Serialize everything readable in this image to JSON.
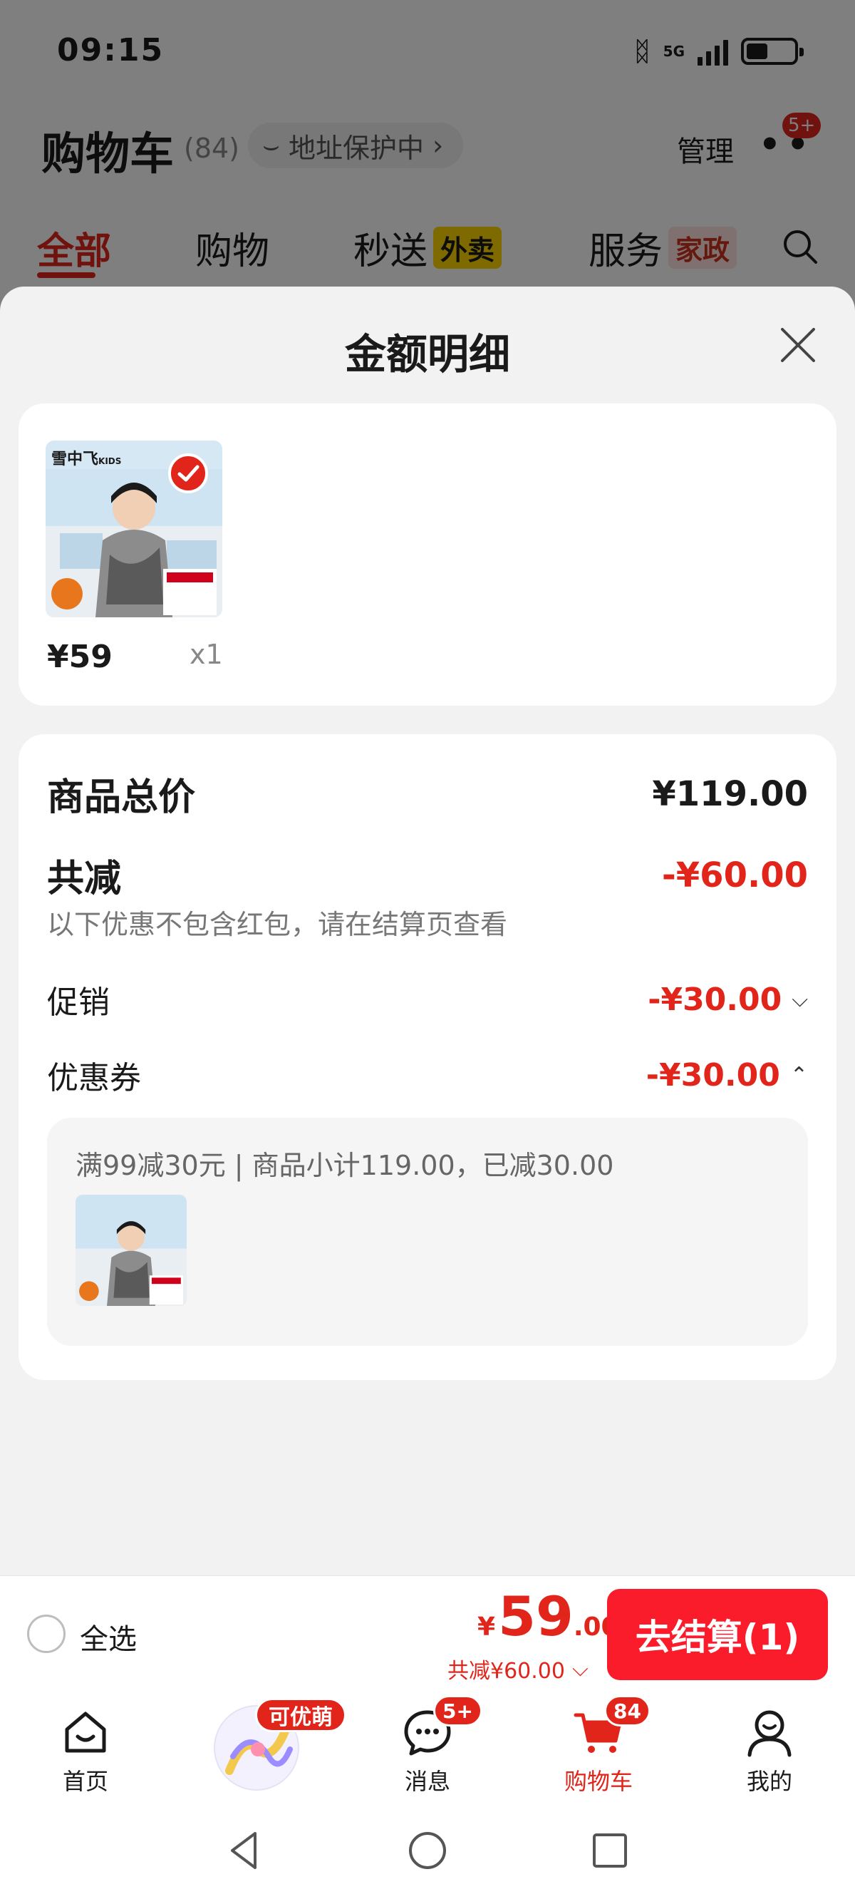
{
  "status_bar": {
    "time": "09:15",
    "network": "5G",
    "bluetooth_icon": "bluetooth-icon",
    "battery_level": 0.45
  },
  "cart_header": {
    "title": "购物车",
    "count": "(84)",
    "address_text": "地址保护中",
    "manage_label": "管理",
    "more_badge": "5+"
  },
  "top_tabs": [
    {
      "label": "全部",
      "tag": ""
    },
    {
      "label": "购物",
      "tag": ""
    },
    {
      "label": "秒送",
      "tag": "外卖"
    },
    {
      "label": "服务",
      "tag": "家政"
    }
  ],
  "sheet": {
    "title": "金额明细",
    "product": {
      "price": "¥59",
      "qty": "x1",
      "brand_text": "雪中飞KIDS"
    },
    "summary": {
      "total_label": "商品总价",
      "total_value": "¥119.00",
      "discount_label": "共减",
      "discount_value": "-¥60.00",
      "note": "以下优惠不包含红包，请在结算页查看",
      "promo_label": "促销",
      "promo_value": "-¥30.00",
      "coupon_label": "优惠券",
      "coupon_value": "-¥30.00",
      "coupon_detail": "满99减30元 | 商品小计119.00，已减30.00"
    }
  },
  "checkout": {
    "select_all": "全选",
    "currency": "¥",
    "price_int": "59",
    "price_dec": ".00",
    "discount_text": "共减¥60.00",
    "button_label": "去结算(1)"
  },
  "bottom_nav": [
    {
      "label": "首页",
      "icon": "home-icon"
    },
    {
      "label": "",
      "icon": "promo-icon",
      "badge": "可优萌"
    },
    {
      "label": "消息",
      "icon": "message-icon",
      "badge": "5+"
    },
    {
      "label": "购物车",
      "icon": "cart-icon",
      "badge": "84"
    },
    {
      "label": "我的",
      "icon": "profile-icon"
    }
  ],
  "colors": {
    "accent": "#e1251b",
    "checkout_button": "#fa1c2b",
    "sheet_bg": "#f2f2f2"
  }
}
